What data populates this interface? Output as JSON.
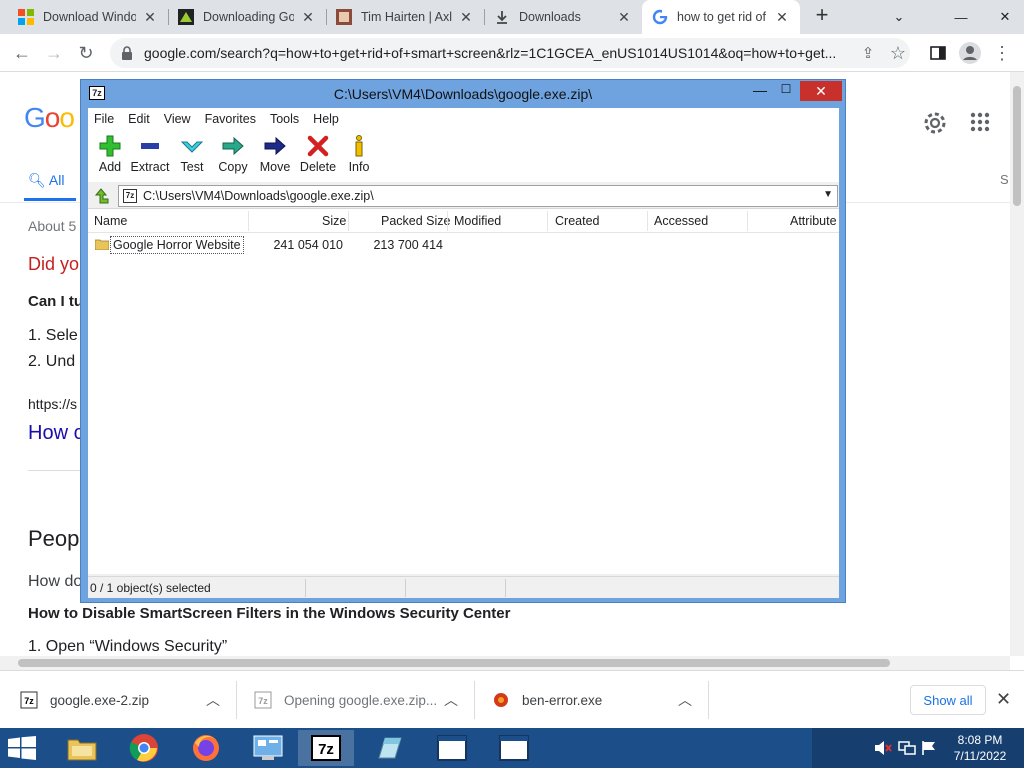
{
  "tabs": [
    {
      "title": "Download Windo",
      "icon": "windows-logo-icon"
    },
    {
      "title": "Downloading Go",
      "icon": "site-favicon-icon"
    },
    {
      "title": "Tim Hairten | Axl",
      "icon": "site-favicon-icon"
    },
    {
      "title": "Downloads",
      "icon": "download-icon"
    },
    {
      "title": "how to get rid of",
      "icon": "google-g-icon",
      "active": true
    }
  ],
  "omnibox": {
    "url": "google.com/search?q=how+to+get+rid+of+smart+screen&rlz=1C1GCEA_enUS1014US1014&oq=how+to+get..."
  },
  "google": {
    "tab_all": "All",
    "tab_s": "S",
    "about": "About 5",
    "did_you": "Did yo",
    "can_i": "Can I tu",
    "step1": "1. Sele",
    "step2": "2. Und",
    "link_url": "https://s",
    "link_title": "How c",
    "people": "Peop",
    "how_do": "How do",
    "heading": "How to Disable SmartScreen Filters in the Windows Security Center",
    "open_step": "1. Open “Windows Security”"
  },
  "zip": {
    "title": "C:\\Users\\VM4\\Downloads\\google.exe.zip\\",
    "menu": [
      "File",
      "Edit",
      "View",
      "Favorites",
      "Tools",
      "Help"
    ],
    "tools": {
      "add": "Add",
      "extract": "Extract",
      "test": "Test",
      "copy": "Copy",
      "move": "Move",
      "delete": "Delete",
      "info": "Info"
    },
    "path": "C:\\Users\\VM4\\Downloads\\google.exe.zip\\",
    "columns": {
      "name": "Name",
      "size": "Size",
      "packed": "Packed Size",
      "modified": "Modified",
      "created": "Created",
      "accessed": "Accessed",
      "attributes": "Attribute"
    },
    "rows": [
      {
        "name": "Google Horror Website",
        "size": "241 054 010",
        "packed": "213 700 414"
      }
    ],
    "status": "0 / 1 object(s) selected"
  },
  "downloads": {
    "items": [
      "google.exe-2.zip",
      "Opening google.exe.zip...",
      "ben-error.exe"
    ],
    "show_all": "Show all"
  },
  "clock": {
    "time": "8:08 PM",
    "date": "7/11/2022"
  },
  "colors": {
    "zip_frame": "#6ea3e0",
    "close_red": "#c7302b",
    "taskbar": "#1c4f8a",
    "link_blue": "#1a0dab",
    "accent_blue": "#1a73e8"
  }
}
